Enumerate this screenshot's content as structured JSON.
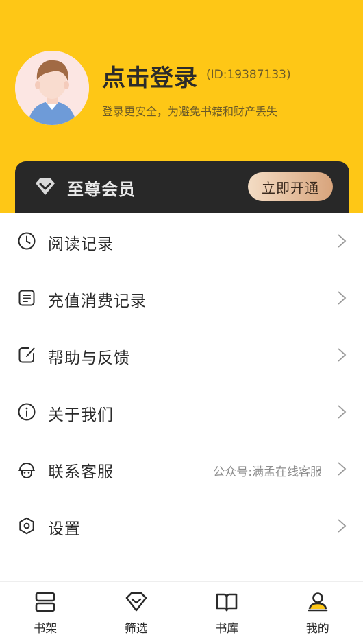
{
  "header": {
    "login_title": "点击登录",
    "user_id": "(ID:19387133)",
    "subtitle": "登录更安全，为避免书籍和财产丢失",
    "background_color": "#FEC716"
  },
  "vip": {
    "title": "至尊会员",
    "button_label": "立即开通",
    "icon": "diamond-icon"
  },
  "menu": {
    "items": [
      {
        "label": "阅读记录",
        "icon": "clock-icon",
        "hint": ""
      },
      {
        "label": "充值消费记录",
        "icon": "receipt-icon",
        "hint": ""
      },
      {
        "label": "帮助与反馈",
        "icon": "edit-icon",
        "hint": ""
      },
      {
        "label": "关于我们",
        "icon": "info-icon",
        "hint": ""
      },
      {
        "label": "联系客服",
        "icon": "headset-icon",
        "hint": "公众号:满孟在线客服"
      },
      {
        "label": "设置",
        "icon": "hexagon-settings-icon",
        "hint": ""
      }
    ]
  },
  "tabbar": {
    "tabs": [
      {
        "label": "书架",
        "icon": "bookshelf-icon"
      },
      {
        "label": "筛选",
        "icon": "diamond-filter-icon"
      },
      {
        "label": "书库",
        "icon": "open-book-icon"
      },
      {
        "label": "我的",
        "icon": "profile-icon",
        "active": true
      }
    ]
  }
}
